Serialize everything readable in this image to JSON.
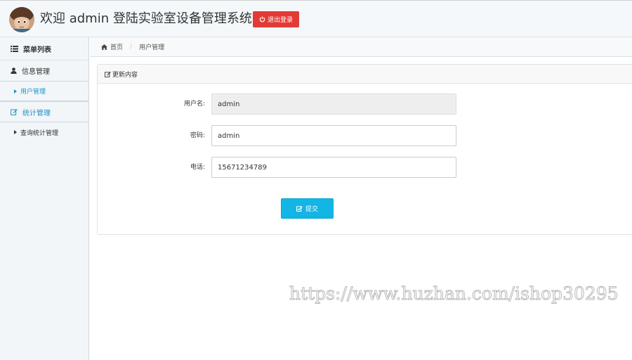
{
  "header": {
    "title": "欢迎 admin 登陆实验室设备管理系统",
    "logout_label": "退出登录"
  },
  "sidebar": {
    "menu_title": "菜单列表",
    "groups": [
      {
        "label": "信息管理",
        "icon": "user-icon",
        "items": [
          {
            "label": "用户管理"
          }
        ]
      },
      {
        "label": "统计管理",
        "icon": "edit-icon",
        "items": [
          {
            "label": "查询统计管理"
          }
        ]
      }
    ]
  },
  "breadcrumb": {
    "home": "首页",
    "current": "用户管理"
  },
  "panel": {
    "title": "更新内容",
    "fields": {
      "username": {
        "label": "用户名:",
        "value": "admin"
      },
      "password": {
        "label": "密码:",
        "value": "admin"
      },
      "phone": {
        "label": "电话:",
        "value": "15671234789"
      }
    },
    "submit_label": "提交"
  },
  "watermark": "https://www.huzhan.com/ishop30295",
  "colors": {
    "accent": "#1c93c7",
    "logout": "#e43a36",
    "submit": "#13b5e4"
  }
}
